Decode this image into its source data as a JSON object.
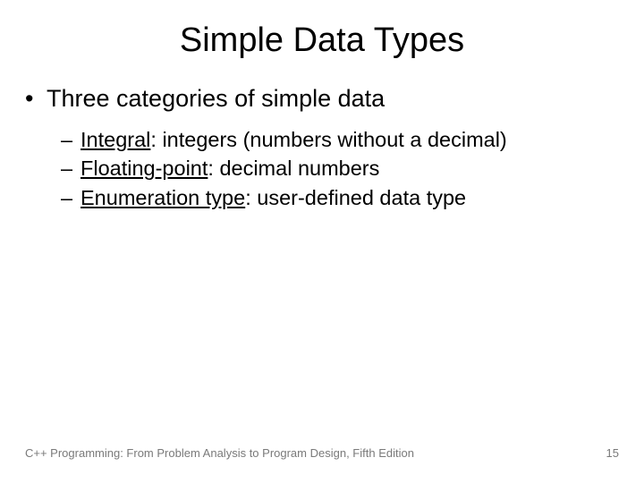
{
  "title": "Simple Data Types",
  "bullet_main": "Three categories of simple data",
  "items": [
    {
      "term": "Integral",
      "desc": ": integers (numbers without a decimal)"
    },
    {
      "term": "Floating-point",
      "desc": ": decimal numbers"
    },
    {
      "term": "Enumeration type",
      "desc": ": user-defined data type"
    }
  ],
  "footer_text": "C++ Programming: From Problem Analysis to Program Design, Fifth Edition",
  "page_number": "15",
  "glyphs": {
    "bullet": "•",
    "dash": "–"
  }
}
